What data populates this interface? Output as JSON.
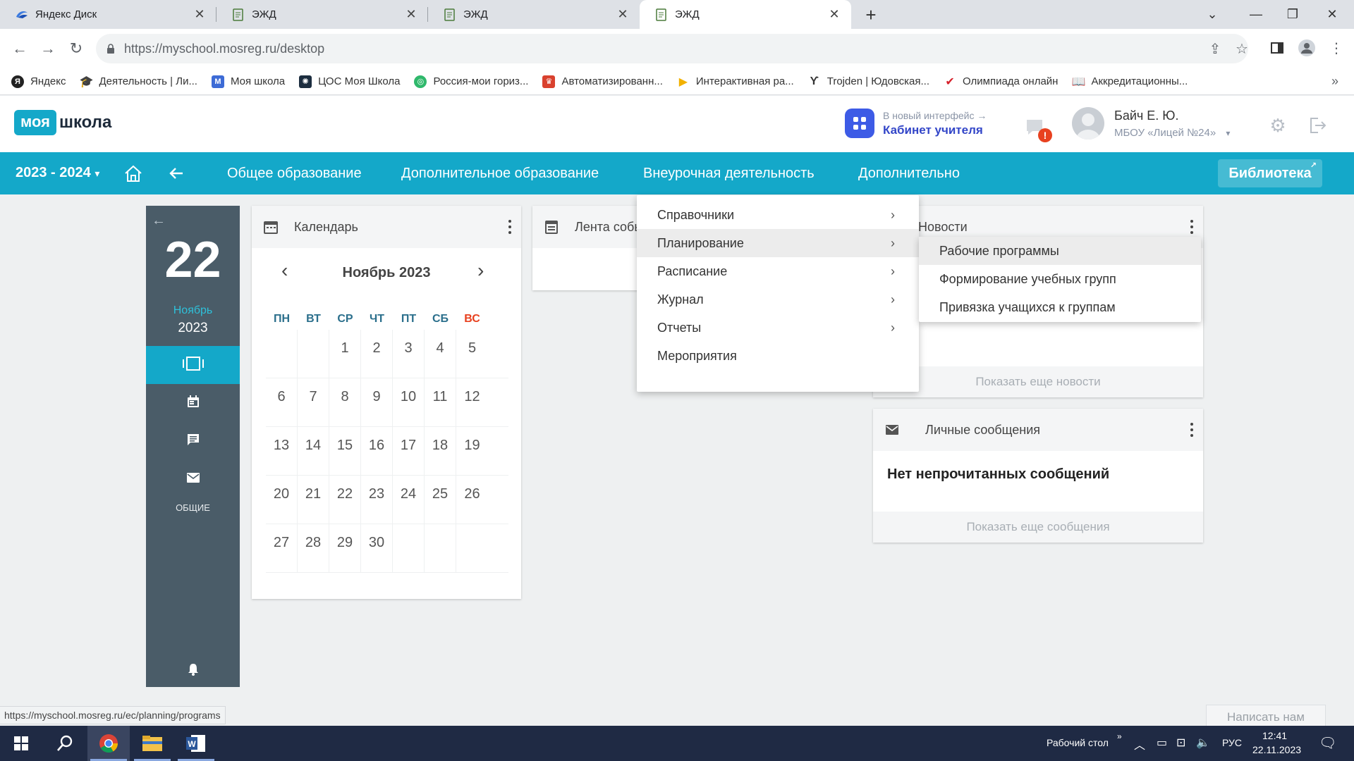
{
  "browser": {
    "tabs": [
      {
        "title": "Яндекс Диск",
        "active": false
      },
      {
        "title": "ЭЖД",
        "active": false
      },
      {
        "title": "ЭЖД",
        "active": false
      },
      {
        "title": "ЭЖД",
        "active": true
      }
    ],
    "url": "https://myschool.mosreg.ru/desktop",
    "bookmarks": [
      {
        "label": "Яндекс",
        "color": "#222222"
      },
      {
        "label": "Деятельность | Ли...",
        "color": "#555555"
      },
      {
        "label": "Моя школа",
        "color": "#3d6bd6"
      },
      {
        "label": "ЦОС Моя Школа",
        "color": "#1c2d3f"
      },
      {
        "label": "Россия-мои гориз...",
        "color": "#2fb86b"
      },
      {
        "label": "Автоматизированн...",
        "color": "#d9412e"
      },
      {
        "label": "Интерактивная ра...",
        "color": "#f2b100"
      },
      {
        "label": "Trojden | Юдовская...",
        "color": "#333333"
      },
      {
        "label": "Олимпиада онлайн",
        "color": "#d6202a"
      },
      {
        "label": "Аккредитационны...",
        "color": "#2a4d8f"
      }
    ]
  },
  "header": {
    "logo_a": "моя",
    "logo_b": "школа",
    "new_ui_small": "В новый интерфейс →",
    "new_ui_big": "Кабинет учителя",
    "user_name": "Байч Е. Ю.",
    "user_org": "МБОУ «Лицей №24»"
  },
  "nav": {
    "year": "2023 - 2024",
    "links": [
      "Общее образование",
      "Дополнительное образование",
      "Внеурочная деятельность",
      "Дополнительно"
    ],
    "library": "Библиотека"
  },
  "sidebar": {
    "day": "22",
    "month": "Ноябрь",
    "year": "2023",
    "label": "ОБЩИЕ"
  },
  "calendar": {
    "title": "Календарь",
    "month_title": "Ноябрь 2023",
    "weekdays": [
      "ПН",
      "ВТ",
      "СР",
      "ЧТ",
      "ПТ",
      "СБ",
      "ВС"
    ],
    "weeks": [
      [
        "",
        "",
        "1",
        "2",
        "3",
        "4",
        "5"
      ],
      [
        "6",
        "7",
        "8",
        "9",
        "10",
        "11",
        "12"
      ],
      [
        "13",
        "14",
        "15",
        "16",
        "17",
        "18",
        "19"
      ],
      [
        "20",
        "21",
        "22",
        "23",
        "24",
        "25",
        "26"
      ],
      [
        "27",
        "28",
        "29",
        "30",
        "",
        "",
        ""
      ]
    ]
  },
  "feed": {
    "title": "Лента собы"
  },
  "news": {
    "title": "Новости",
    "more": "Показать еще новости"
  },
  "messages": {
    "title": "Личные сообщения",
    "empty": "Нет непрочитанных сообщений",
    "more": "Показать еще сообщения"
  },
  "menu": {
    "items": [
      "Справочники",
      "Планирование",
      "Расписание",
      "Журнал",
      "Отчеты",
      "Мероприятия"
    ],
    "submenu": [
      "Рабочие программы",
      "Формирование учебных групп",
      "Привязка учащихся к группам"
    ]
  },
  "status_url": "https://myschool.mosreg.ru/ec/planning/programs",
  "write_us": "Написать нам",
  "taskbar": {
    "desktop": "Рабочий стол",
    "lang": "РУС",
    "time": "12:41",
    "date": "22.11.2023"
  }
}
